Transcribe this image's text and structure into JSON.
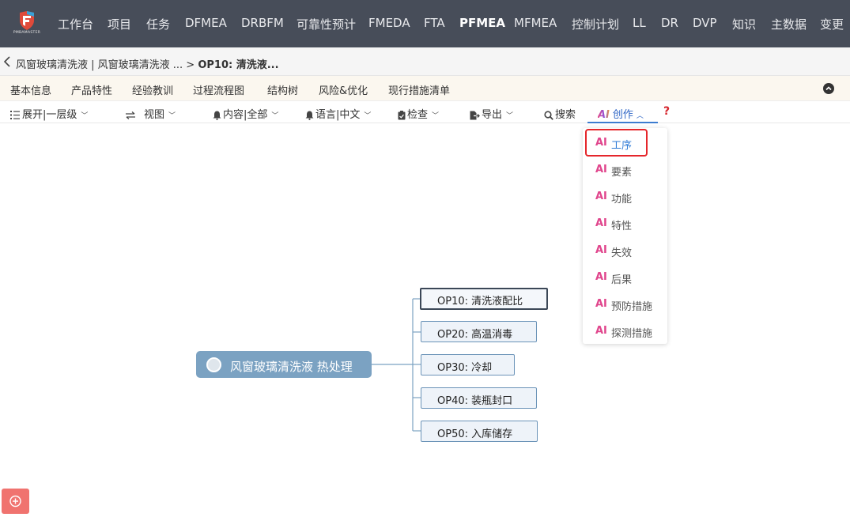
{
  "brand": {
    "logo_text": "PMBAMASTER"
  },
  "topnav": {
    "items": [
      "工作台",
      "项目",
      "任务",
      "DFMEA",
      "DRBFM",
      "可靠性预计",
      "FMEDA",
      "FTA",
      "PFMEA",
      "MFMEA",
      "控制计划",
      "LL",
      "DR",
      "DVP",
      "知识",
      "主数据",
      "变更"
    ],
    "active": "PFMEA"
  },
  "breadcrumb": {
    "back_icon": "chevron-left-icon",
    "path": "风窗玻璃清洗液 | 风窗玻璃清洗液 ... > ",
    "current": "OP10: 清洗液..."
  },
  "tabs": [
    "基本信息",
    "产品特性",
    "经验教训",
    "过程流程图",
    "结构树",
    "风险&优化",
    "现行措施清单"
  ],
  "toolbar": {
    "expand": "展开|一层级",
    "view": "视图",
    "content": "内容|全部",
    "language": "语言|中文",
    "check": "检查",
    "export": "导出",
    "search": "搜索",
    "create": "创作",
    "help": "?",
    "ai_glyph": "AI"
  },
  "ai_menu": {
    "prefix": "AI",
    "items": [
      "工序",
      "要素",
      "功能",
      "特性",
      "失效",
      "后果",
      "预防措施",
      "探测措施"
    ],
    "highlighted": "工序"
  },
  "mindmap": {
    "root": "风窗玻璃清洗液 热处理",
    "children": [
      "OP10: 清洗液配比",
      "OP20: 高温消毒",
      "OP30: 冷却",
      "OP40: 装瓶封口",
      "OP50: 入库储存"
    ],
    "selected": "OP10: 清洗液配比"
  },
  "colors": {
    "topnav_bg": "#474d59",
    "root_node": "#7ba2c2",
    "node_border": "#6b93b8",
    "accent_blue": "#2f66c6",
    "ai_pink": "#e0458c",
    "highlight_red": "#e5262b",
    "float_button": "#f0736f"
  }
}
